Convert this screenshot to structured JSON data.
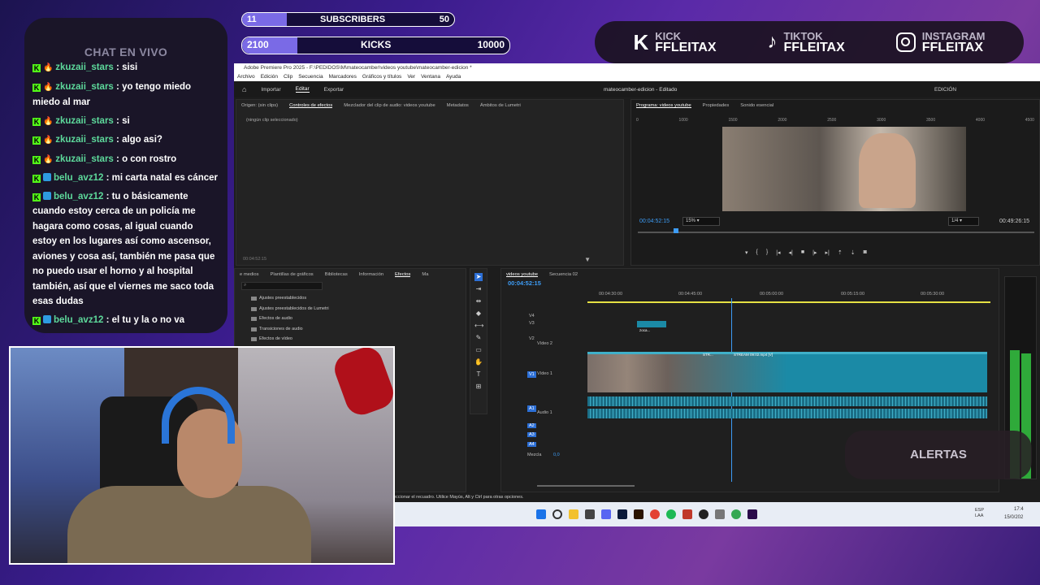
{
  "overlay": {
    "subscribers": {
      "current": "11",
      "label": "SUBSCRIBERS",
      "goal": "50",
      "progress": 0.22
    },
    "kicks": {
      "current": "2100",
      "label": "KICKS",
      "goal": "10000",
      "progress": 0.21
    },
    "socials": [
      {
        "network": "KICK",
        "handle": "FFLEITAX",
        "icon": "kick-icon"
      },
      {
        "network": "TIKTOK",
        "handle": "FFLEITAX",
        "icon": "tiktok-icon"
      },
      {
        "network": "INSTAGRAM",
        "handle": "FFLEITAX",
        "icon": "instagram-icon"
      }
    ],
    "alerts_label": "ALERTAS"
  },
  "chat": {
    "title": "CHAT EN VIVO",
    "messages": [
      {
        "user": "zkuzaii_stars",
        "text": ": sisi"
      },
      {
        "user": "zkuzaii_stars",
        "text": ": yo tengo miedo miedo al mar"
      },
      {
        "user": "zkuzaii_stars",
        "text": ": si"
      },
      {
        "user": "zkuzaii_stars",
        "text": ": algo asi?"
      },
      {
        "user": "zkuzaii_stars",
        "text": ": o con rostro"
      },
      {
        "user": "belu_avz12",
        "text": ": mi carta natal es cáncer"
      },
      {
        "user": "belu_avz12",
        "text": ": tu o básicamente cuando estoy cerca de un policía me hagara como cosas, al igual cuando estoy en los lugares así como ascensor, aviones y cosa así, también me pasa que no puedo usar el horno y al hospital también, así que el viernes me saco toda esas dudas"
      },
      {
        "user": "belu_avz12",
        "text": ": el tu y la o no va"
      }
    ]
  },
  "premiere": {
    "title": "Adobe Premiere Pro 2025 - F:\\PEDIDOS\\M\\mateocamber\\videos youtube\\mateocamber-edicion *",
    "menu": [
      "Archivo",
      "Edición",
      "Clip",
      "Secuencia",
      "Marcadores",
      "Gráficos y títulos",
      "Ver",
      "Ventana",
      "Ayuda"
    ],
    "nav": [
      "Importar",
      "Editar",
      "Exportar"
    ],
    "project_title": "mateocamber-edicion - Editado",
    "workspace": "EDICIÓN",
    "source_tabs": [
      "Origen: (sin clips)",
      "Controles de efectos",
      "Mezclador del clip de audio: videos youtube",
      "Metadatos",
      "Ámbitos de Lumetri"
    ],
    "no_clip": "(ningún clip seleccionado)",
    "source_time": "00:04:52:15",
    "program_tabs": [
      "Programa: videos youtube",
      "Propiedades",
      "Sonido esencial"
    ],
    "ruler": [
      "0",
      "1000",
      "1500",
      "2000",
      "2500",
      "3000",
      "3500",
      "4000",
      "4500"
    ],
    "program_time": "00:04:52:15",
    "zoom": "15%",
    "quality": "1/4",
    "duration": "00:49:26:15",
    "effects_tabs": [
      "e medios",
      "Plantillas de gráficos",
      "Bibliotecas",
      "Información",
      "Efectos",
      "Ma"
    ],
    "effects_folders": [
      "Ajustes preestablecidos",
      "Ajustes preestablecidos de Lumetri",
      "Efectos de audio",
      "Transiciones de audio",
      "Efectos de vídeo"
    ],
    "timeline_tabs": [
      "videos youtube",
      "Secuencia 02"
    ],
    "timeline_time": "00:04:52:15",
    "timecodes": [
      "00:04:30:00",
      "00:04:45:00",
      "00:05:00:00",
      "00:05:15:00",
      "00:05:30:00"
    ],
    "tracks": {
      "v4": "V4",
      "v3": "V3",
      "v2": "V2",
      "v2_name": "Vídeo 2",
      "v1": "V1",
      "v1_name": "Vídeo 1",
      "a1": "A1",
      "a1_name": "Audio 1",
      "a2": "A2",
      "a3": "A3",
      "a4": "A4",
      "mix": "Mezcla",
      "mix_val": "0,0"
    },
    "clip_labels": [
      "zoca...",
      "STR...",
      "STREAM 09:02.mp4 [V]"
    ],
    "status": "eccionar el recuadro. Utilice Mayús, Alt y Ctrl para otras opciones.",
    "tray": {
      "lang": "ESP\nLAA",
      "time": "17:4",
      "date": "15/0/202"
    }
  }
}
